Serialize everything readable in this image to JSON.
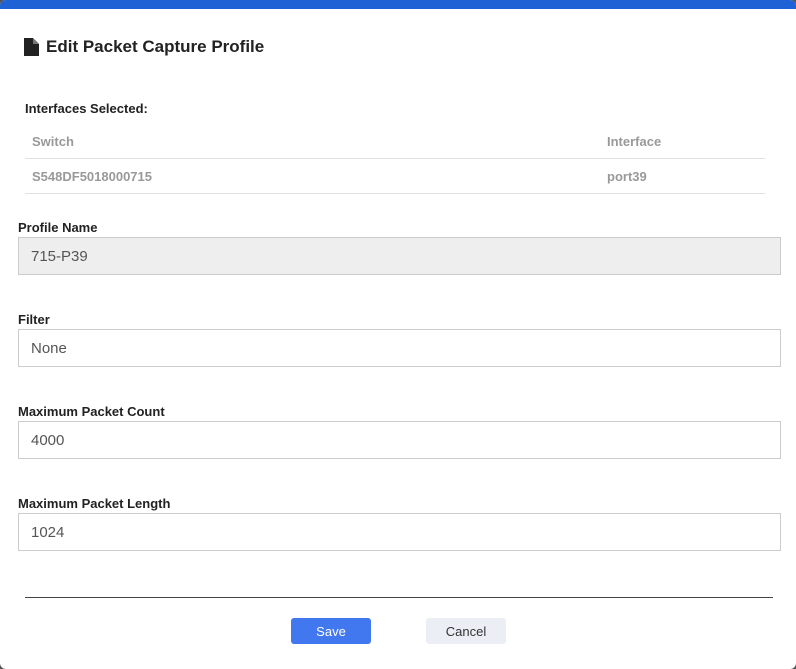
{
  "dialog": {
    "title": "Edit Packet Capture Profile",
    "title_icon": "file-icon",
    "accent": "#1f62d6"
  },
  "interfaces": {
    "label": "Interfaces Selected:",
    "columns": [
      "Switch",
      "Interface"
    ],
    "rows": [
      [
        "S548DF5018000715",
        "port39"
      ]
    ]
  },
  "fields": {
    "profile_name": {
      "label": "Profile Name",
      "value": "715-P39"
    },
    "filter": {
      "label": "Filter",
      "value": "None"
    },
    "max_count": {
      "label": "Maximum Packet Count",
      "value": "4000"
    },
    "max_length": {
      "label": "Maximum Packet Length",
      "value": "1024"
    }
  },
  "buttons": {
    "save": "Save",
    "cancel": "Cancel"
  }
}
